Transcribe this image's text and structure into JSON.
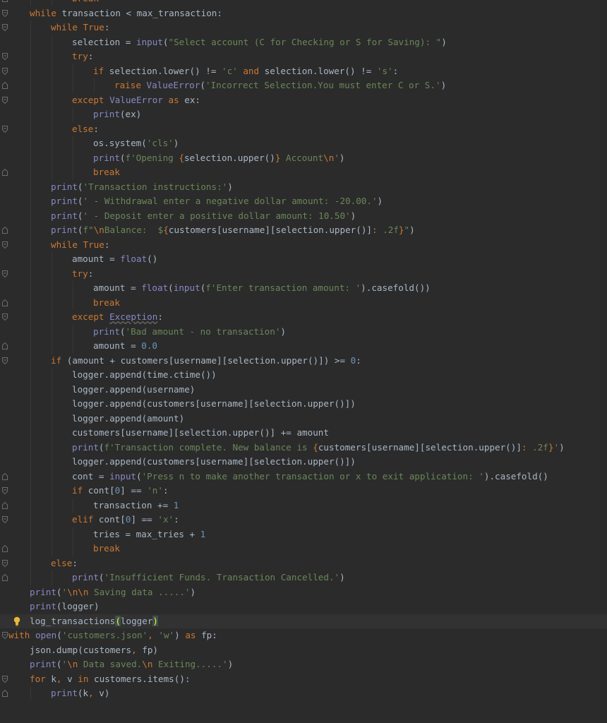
{
  "editor": {
    "lines": [
      {
        "indent": 3,
        "text": "break",
        "partial": true
      },
      {
        "indent": 1,
        "text": "while transaction < max_transaction:"
      },
      {
        "indent": 2,
        "text": "while True:"
      },
      {
        "indent": 3,
        "text": "selection = input(\"Select account (C for Checking or S for Saving): \")"
      },
      {
        "indent": 3,
        "text": "try:"
      },
      {
        "indent": 4,
        "text": "if selection.lower() != 'c' and selection.lower() != 's':"
      },
      {
        "indent": 5,
        "text": "raise ValueError('Incorrect Selection.You must enter C or S.')"
      },
      {
        "indent": 3,
        "text": "except ValueError as ex:"
      },
      {
        "indent": 4,
        "text": "print(ex)"
      },
      {
        "indent": 3,
        "text": "else:"
      },
      {
        "indent": 4,
        "text": "os.system('cls')"
      },
      {
        "indent": 4,
        "text": "print(f'Opening {selection.upper()} Account\\n')"
      },
      {
        "indent": 4,
        "text": "break"
      },
      {
        "indent": 2,
        "text": "print('Transaction instructions:')"
      },
      {
        "indent": 2,
        "text": "print(' - Withdrawal enter a negative dollar amount: -20.00.')"
      },
      {
        "indent": 2,
        "text": "print(' - Deposit enter a positive dollar amount: 10.50')"
      },
      {
        "indent": 2,
        "text": "print(f\"\\nBalance:  ${customers[username][selection.upper()]: .2f}\")"
      },
      {
        "indent": 2,
        "text": "while True:"
      },
      {
        "indent": 3,
        "text": "amount = float()"
      },
      {
        "indent": 3,
        "text": "try:"
      },
      {
        "indent": 4,
        "text": "amount = float(input(f'Enter transaction amount: ').casefold())"
      },
      {
        "indent": 4,
        "text": "break"
      },
      {
        "indent": 3,
        "text": "except Exception:"
      },
      {
        "indent": 4,
        "text": "print('Bad amount - no transaction')"
      },
      {
        "indent": 4,
        "text": "amount = 0.0"
      },
      {
        "indent": 2,
        "text": "if (amount + customers[username][selection.upper()]) >= 0:"
      },
      {
        "indent": 3,
        "text": "logger.append(time.ctime())"
      },
      {
        "indent": 3,
        "text": "logger.append(username)"
      },
      {
        "indent": 3,
        "text": "logger.append(customers[username][selection.upper()])"
      },
      {
        "indent": 3,
        "text": "logger.append(amount)"
      },
      {
        "indent": 3,
        "text": "customers[username][selection.upper()] += amount"
      },
      {
        "indent": 3,
        "text": "print(f'Transaction complete. New balance is {customers[username][selection.upper()]: .2f}')"
      },
      {
        "indent": 3,
        "text": "logger.append(customers[username][selection.upper()])"
      },
      {
        "indent": 3,
        "text": "cont = input('Press n to make another transaction or x to exit application: ').casefold()"
      },
      {
        "indent": 3,
        "text": "if cont[0] == 'n':"
      },
      {
        "indent": 4,
        "text": "transaction += 1"
      },
      {
        "indent": 3,
        "text": "elif cont[0] == 'x':"
      },
      {
        "indent": 4,
        "text": "tries = max_tries + 1"
      },
      {
        "indent": 4,
        "text": "break"
      },
      {
        "indent": 2,
        "text": "else:"
      },
      {
        "indent": 3,
        "text": "print('Insufficient Funds. Transaction Cancelled.')"
      },
      {
        "indent": 1,
        "text": "print('\\n\\n Saving data .....')"
      },
      {
        "indent": 1,
        "text": "print(logger)"
      },
      {
        "indent": 1,
        "text": "log_transactions(logger)",
        "current": true
      },
      {
        "indent": 0,
        "text": "with open('customers.json', 'w') as fp:"
      },
      {
        "indent": 1,
        "text": "json.dump(customers, fp)"
      },
      {
        "indent": 1,
        "text": "print('\\n Data saved.\\n Exiting.....')"
      },
      {
        "indent": 1,
        "text": "for k, v in customers.items():"
      },
      {
        "indent": 2,
        "text": "print(k, v)"
      }
    ]
  },
  "colors": {
    "background": "#2b2b2b",
    "current_line": "#323232",
    "default_text": "#a9b7c6",
    "keyword": "#cc7832",
    "string": "#6a8759",
    "number": "#6897bb",
    "builtin": "#8888c6",
    "bracket_highlight": "#ffef28"
  },
  "icons": {
    "fold_marker": "fold-marker-icon",
    "intention": "lightbulb-icon"
  }
}
